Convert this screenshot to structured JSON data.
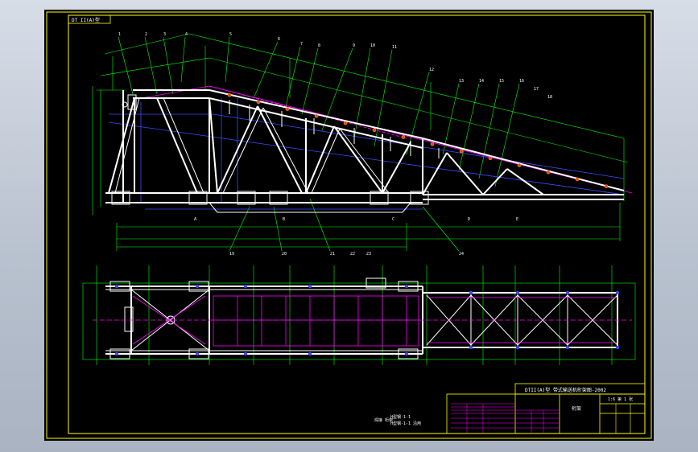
{
  "drawing": {
    "sheet_tag": "DT II(A)型",
    "title_line": "DTII(A)型  带式输送机桁架图-2002",
    "scale_text": "1:6  第 1 张",
    "name_cell": "桁架",
    "notes": [
      "H型钢-1-1",
      "H型钢-1-1 沿用",
      "焊接 桁架"
    ],
    "callouts": [
      "1",
      "2",
      "3",
      "4",
      "5",
      "6",
      "7",
      "8",
      "9",
      "10",
      "11",
      "12",
      "13",
      "14",
      "15",
      "16",
      "17",
      "18",
      "19",
      "20",
      "21",
      "22",
      "23",
      "24"
    ],
    "section_marks": [
      "A",
      "B",
      "C",
      "D",
      "E"
    ],
    "colors": {
      "background": "#000000",
      "frame": "#ffff00",
      "structure": "#ffffff",
      "centerline": "#ff00ff",
      "hidden": "#0000ff",
      "dimension": "#00ff00",
      "marker": "#ff3333"
    }
  }
}
